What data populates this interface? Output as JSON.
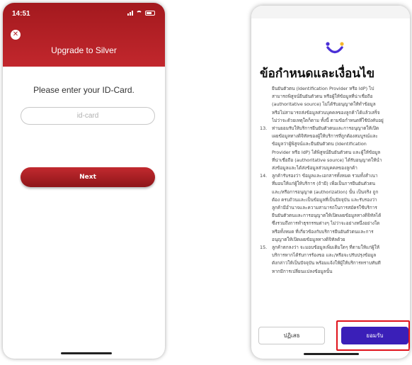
{
  "left_screen": {
    "status_time": "14:51",
    "title": "Upgrade to Silver",
    "prompt": "Please enter your ID-Card.",
    "id_input": {
      "placeholder": "id-card",
      "value": ""
    },
    "next_label": "Next",
    "header_color": "#b52227"
  },
  "right_screen": {
    "title": "ข้อกำหนดและเงื่อนไข",
    "logo_colors": [
      "#4a2fd6",
      "#f5b82e"
    ],
    "terms": [
      {
        "num": "",
        "lines": [
          "ยืนยันตัวตน (Identification Provider หรือ IdP) ไป",
          "สามารถพิสูจน์ยืนยันตัวตน หรือผู้ให้ข้อมูลที่น่าเชื่อถือ",
          "(authoritative source) ไม่ได้รับอนุญาตให้ทำข้อมูล",
          "หรือไม่สามารถส่งข้อมูลส่วนบุคคลของลูกค้าได้แล้วเสร็จ",
          "ไม่ว่าจะด้วยเหตุใดก็ตาม ทั้งนี้ ตามข้อกำหนดที่ใช้บังคับอยู่"
        ]
      },
      {
        "num": "13.",
        "lines": [
          "ท่านยอมรับให้บริการยืนยันตัวตนและการอนุญาตให้เปิด",
          "เผยข้อมูลทางดิจิทัลของผู้ให้บริการที่ถูกต้องสมบูรณ์และ",
          "ข้อมูลว่าผู้พิสูจน์และยืนยันตัวตน (Identification",
          "Provider หรือ IdP) ได้พิสูจน์ยืนยันตัวตน และผู้ให้ข้อมูล",
          "ที่น่าเชื่อถือ (authoritative source) ได้รับอนุญาตให้นำ",
          "ส่งข้อมูลและได้ส่งข้อมูลส่วนบุคคลของลูกค้า"
        ]
      },
      {
        "num": "14.",
        "lines": [
          "ลูกค้ารับรองว่า ข้อมูลและเอกสารทั้งหมด รวมทั้งสำเนา",
          "ที่มอบให้แก่ผู้ให้บริการ (ถ้ามี) เพื่อเป็นการยืนยันตัวตน",
          "และ/หรือการอนุญาต (authorization) นั้น เป็นจริง ถูก",
          "ต้อง ครบถ้วนและเป็นข้อมูลที่เป็นปัจจุบัน และรับรองว่า",
          "ลูกค้ามีอำนาจและความสามารถในการสมัครใช้บริการ",
          "ยืนยันตัวตนและการอนุญาตให้เปิดเผยข้อมูลทางดิจิทัลได้",
          "ซึ่งรวมถึงการทำธุรกรรมต่างๆ ไม่ว่าจะอย่างหนึ่งอย่างใด",
          "หรือทั้งหมด ที่เกี่ยวข้องกับบริการยืนยันตัวตนและการ",
          "อนุญาตให้เปิดเผยข้อมูลทางดิจิทัลด้วย"
        ]
      },
      {
        "num": "15.",
        "lines": [
          "ลูกค้าตกลงว่า จะมอบข้อมูลเพิ่มเติมใดๆ ที่ตามให้แก่ผู้ให้",
          "บริการหากได้รับการร้องขอ และ/หรือจะปรับปรุงข้อมูล",
          "ดังกล่าวให้เป็นปัจจุบัน พร้อมแจ้งให้ผู้ให้บริการทราบทันที",
          "หากมีการเปลี่ยนแปลงข้อมูลนั้น"
        ]
      }
    ],
    "decline_label": "ปฏิเสธ",
    "accept_label": "ยอมรับ",
    "accept_color": "#3a1fb8",
    "highlight_color": "#e0121b"
  }
}
